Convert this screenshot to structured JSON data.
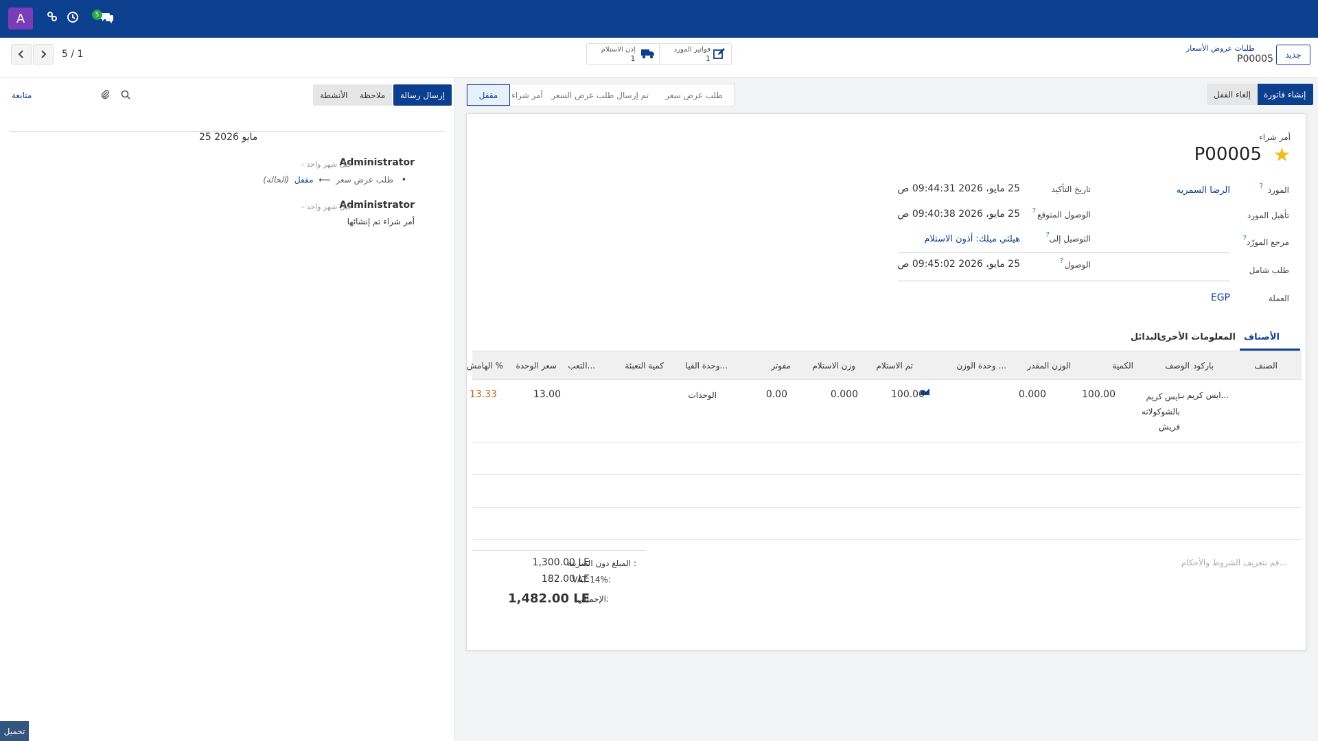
{
  "topbar": {
    "avatar_letter": "A",
    "badge_count": "5",
    "colors": {
      "bar": "#0d3f8f",
      "avatar": "#7a3db8",
      "badge": "#28a745"
    }
  },
  "control": {
    "pager": "5 / 1",
    "breadcrumb_parent": "طلبات عروض الأسعار",
    "breadcrumb_current": "P00005",
    "new_button": "جديد",
    "smart_buttons": [
      {
        "label": "فواتير المورد",
        "count": "1",
        "icon": "edit-icon"
      },
      {
        "label": "إذن الاستلام",
        "count": "1",
        "icon": "truck-icon"
      }
    ]
  },
  "chatter": {
    "send_message": "إرسال رسالة",
    "note": "ملاحظة",
    "activities": "الأنشطة",
    "follow": "متابعة",
    "date_separator": "25 مايو 2026",
    "messages": [
      {
        "author": "Administrator",
        "time": "- قبل شهر واحد",
        "change_from": "طلب عرض سعر",
        "arrow": "⟵",
        "change_to": "مقفل",
        "field": "(الحالة)"
      },
      {
        "author": "Administrator",
        "time": "- قبل شهر واحد",
        "body": "أمر شراء تم إنشائها"
      }
    ],
    "upload": "تحميل"
  },
  "actions": {
    "create_invoice": "إنشاء فاتورة",
    "unlock": "إلغاء القفل"
  },
  "statusbar": {
    "stages": [
      "طلب عرض سعر",
      "تم إرسال طلب عرض السعر",
      "أمر شراء",
      "مقفل"
    ],
    "current": "مقفل"
  },
  "form": {
    "type_label": "أمر شراء",
    "reference": "P00005",
    "vendor_label": "المورد",
    "vendor": "الرضا السمريه",
    "vendor_qualification_label": "تأهيل المورد",
    "vendor_ref_label": "مرجع المورّد",
    "blanket_label": "طلب شامل",
    "currency_label": "العملة",
    "currency": "EGP",
    "confirmation_date_label": "تاريخ التأكيد",
    "confirmation_date": "25 مايو، 2026 09:44:31 ص",
    "expected_arrival_label": "الوصول المتوقع",
    "expected_arrival": "25 مايو، 2026 09:40:38 ص",
    "deliver_to_label": "التوصيل إلى",
    "deliver_to": "هيلثي ميلك: أذون الاستلام",
    "arrival_label": "الوصول",
    "arrival": "25 مايو، 2026 09:45:02 ص"
  },
  "tabs": [
    "الأصناف",
    "المعلومات الأخرى",
    "البدائل"
  ],
  "lines": {
    "columns": [
      "الصنف",
      "باركود",
      "الوصف",
      "الكمية",
      "الوزن المقدر",
      "وحدة الوزن ...",
      "تم الاستلام",
      "وزن الاستلام",
      "مفوتر",
      "وحدة القيا...",
      "كمية التعبئة",
      "التعب...",
      "سعر الوحدة",
      "الهامش %"
    ],
    "rows": [
      {
        "product": "ايس كريم بـ...",
        "description": "ايس كريم بالشوكولاته فريش",
        "quantity": "100.00",
        "estimated_weight": "0.000",
        "received": "100.00",
        "received_weight": "0.000",
        "billed": "0.00",
        "uom": "الوحدات",
        "unit_price": "13.00",
        "margin": "13.33"
      }
    ]
  },
  "terms_placeholder": "قم بتعريف الشروط والأحكام...",
  "totals": {
    "untaxed_label": "المبلغ دون الضريبة :",
    "untaxed": "1,300.00 LE",
    "vat_label": "VAT 14%:",
    "vat": "182.00 LE",
    "total_label": "الإجمالي:",
    "total": "1,482.00 LE"
  }
}
